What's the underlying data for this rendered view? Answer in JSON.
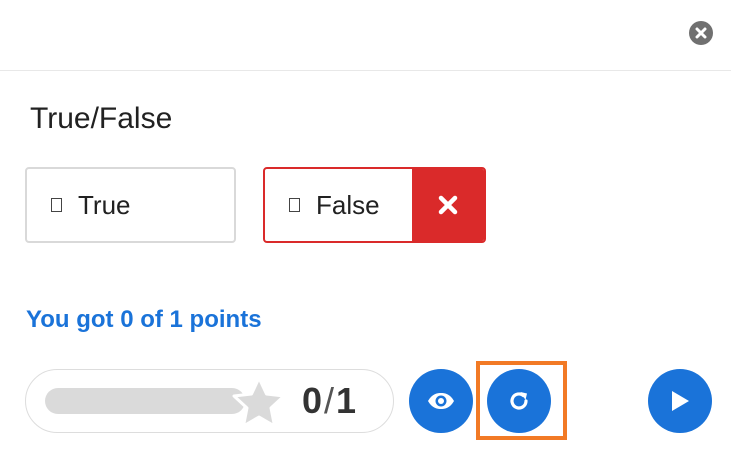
{
  "header": {
    "close_icon": "close-circle-icon"
  },
  "question": {
    "title": "True/False"
  },
  "options": [
    {
      "label": "True",
      "selected": false,
      "state": "neutral"
    },
    {
      "label": "False",
      "selected": true,
      "state": "wrong",
      "mark_icon": "x-icon"
    }
  ],
  "feedback": {
    "score_text": "You got 0 of 1 points"
  },
  "score": {
    "current": "0",
    "separator": "/",
    "total": "1",
    "progress_fraction": 0,
    "star_icon": "star-icon"
  },
  "actions": {
    "show_solution_icon": "eye-icon",
    "retry_icon": "retry-icon",
    "next_icon": "play-icon"
  },
  "colors": {
    "accent": "#1a73d9",
    "wrong": "#da2a2a",
    "focus": "#f27a25",
    "track": "#dadada"
  }
}
